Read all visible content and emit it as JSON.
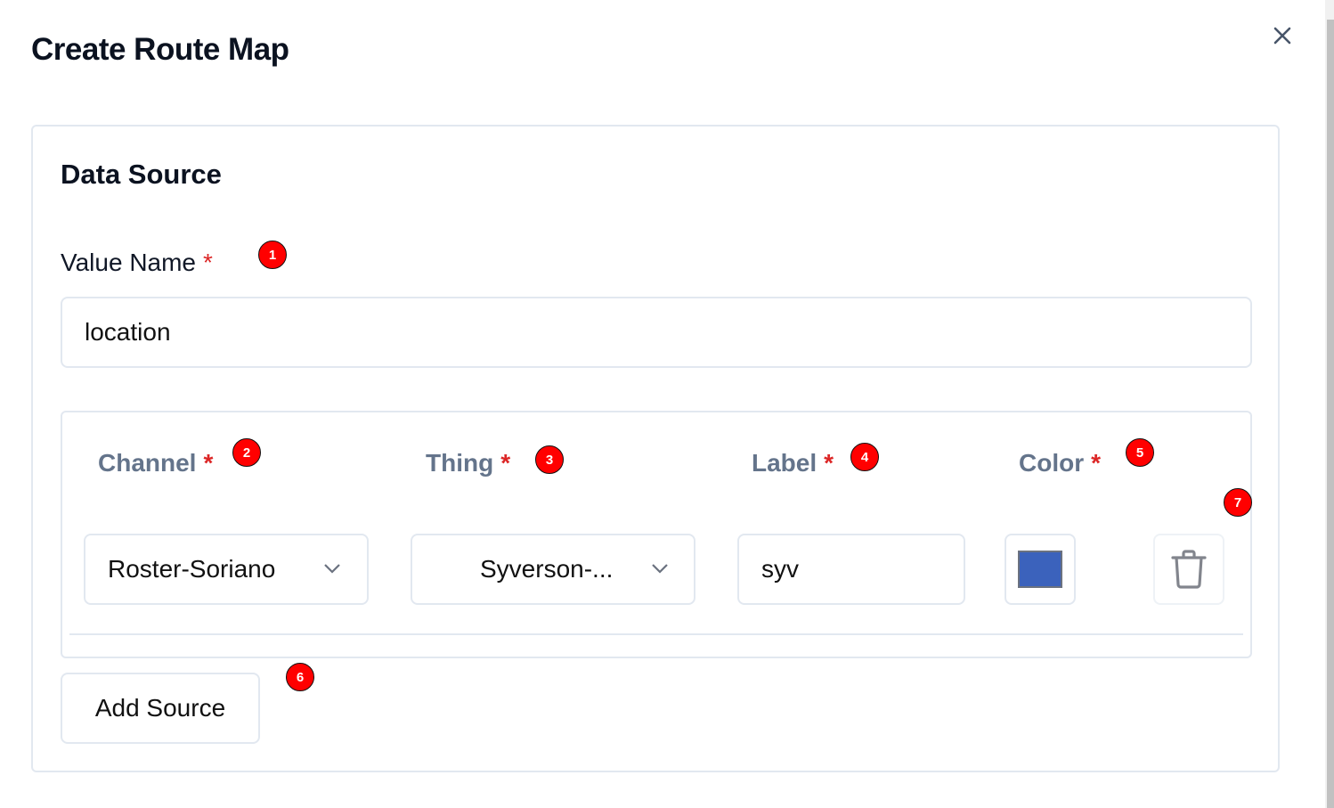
{
  "dialog": {
    "title": "Create Route Map",
    "close_icon": "x-icon"
  },
  "data_source": {
    "heading": "Data Source",
    "value_name": {
      "label": "Value Name",
      "required_mark": "*",
      "value": "location"
    },
    "columns": {
      "channel": {
        "label": "Channel",
        "required_mark": "*",
        "value": "Roster-Soriano"
      },
      "thing": {
        "label": "Thing",
        "required_mark": "*",
        "value": "Syverson-..."
      },
      "label": {
        "label": "Label",
        "required_mark": "*",
        "value": "syv"
      },
      "color": {
        "label": "Color",
        "required_mark": "*",
        "value": "#3b62bc"
      }
    },
    "delete_icon": "trash-icon",
    "add_source_label": "Add Source"
  },
  "markers": [
    "1",
    "2",
    "3",
    "4",
    "5",
    "6",
    "7"
  ]
}
